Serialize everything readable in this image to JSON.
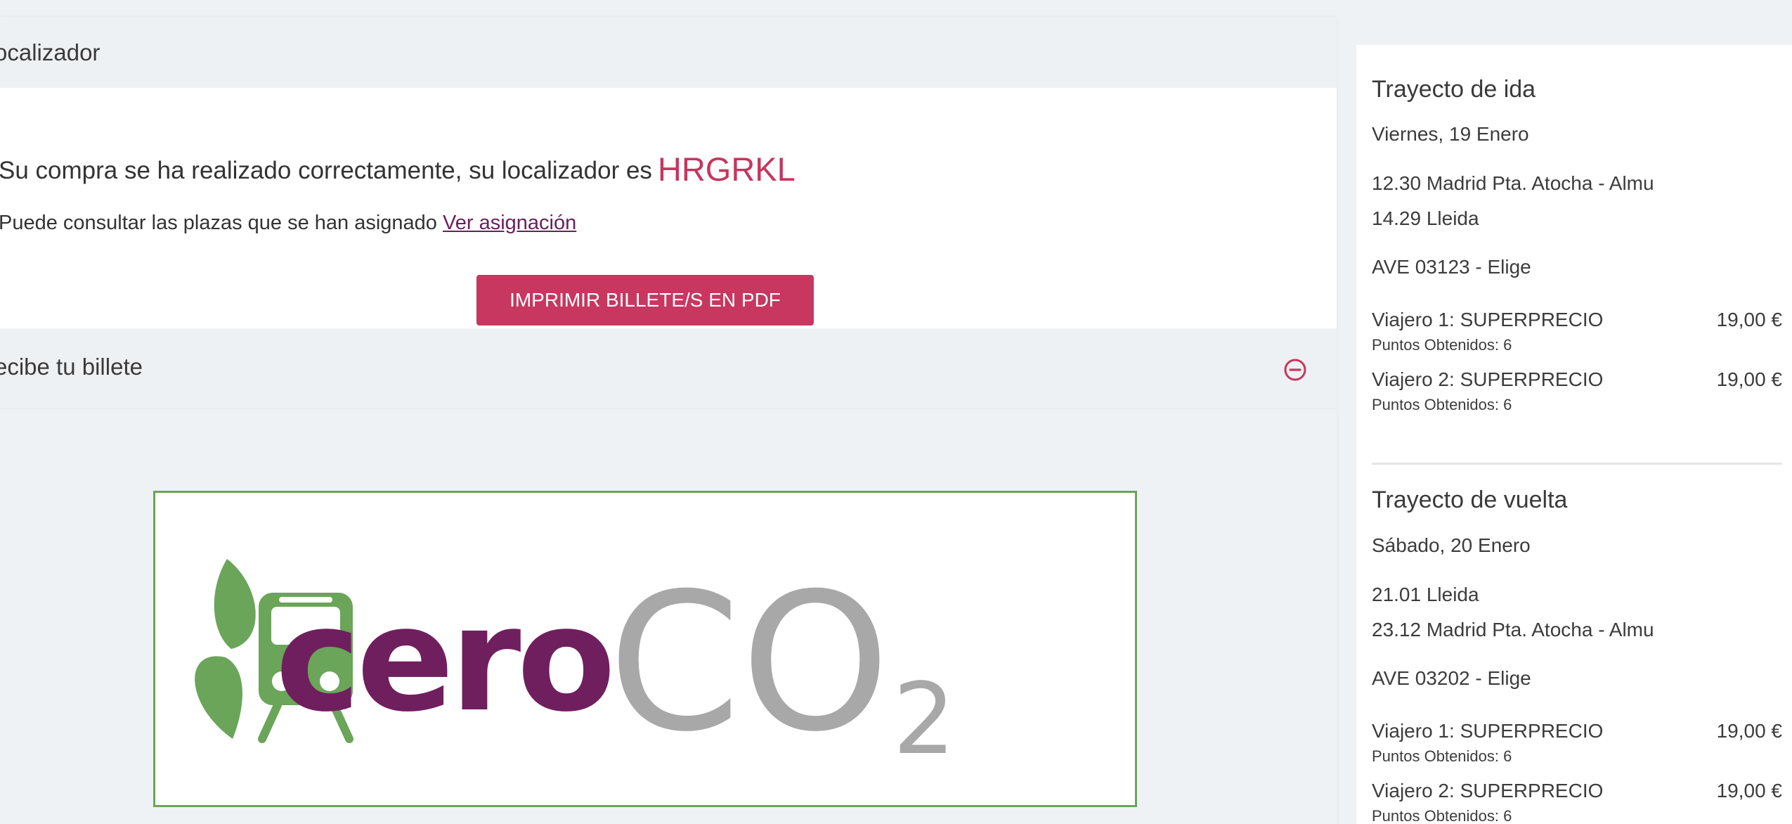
{
  "localizador_section": {
    "title": "ocalizador",
    "message": "Su compra se ha realizado correctamente, su localizador es",
    "code": "HRGRKL",
    "seats_text": "Puede consultar las plazas que se han asignado",
    "seats_link": "Ver asignación",
    "print_button": "IMPRIMIR BILLETE/S EN PDF"
  },
  "recibe_section": {
    "title": "ecibe tu billete",
    "collapse_icon": "minus-circle-icon"
  },
  "logo": {
    "word_cero": "cero",
    "word_co": "CO",
    "subscript": "2",
    "colors": {
      "green": "#6aa55a",
      "purple": "#6f1f5e",
      "gray": "#a8a8a8"
    }
  },
  "sidebar": {
    "ida": {
      "title": "Trayecto de ida",
      "date": "Viernes, 19 Enero",
      "departure": "12.30 Madrid Pta. Atocha - Almu",
      "arrival": "14.29 Lleida",
      "train": "AVE 03123 - Elige",
      "travelers": [
        {
          "label": "Viajero 1: SUPERPRECIO",
          "price": "19,00 €",
          "points": "Puntos Obtenidos: 6"
        },
        {
          "label": "Viajero 2: SUPERPRECIO",
          "price": "19,00 €",
          "points": "Puntos Obtenidos: 6"
        }
      ]
    },
    "vuelta": {
      "title": "Trayecto de vuelta",
      "date": "Sábado, 20 Enero",
      "departure": "21.01 Lleida",
      "arrival": "23.12 Madrid Pta. Atocha - Almu",
      "train": "AVE 03202 - Elige",
      "travelers": [
        {
          "label": "Viajero 1: SUPERPRECIO",
          "price": "19,00 €",
          "points": "Puntos Obtenidos: 6"
        },
        {
          "label": "Viajero 2: SUPERPRECIO",
          "price": "19,00 €",
          "points": "Puntos Obtenidos: 6"
        }
      ]
    }
  },
  "accent_color": "#c7375f"
}
